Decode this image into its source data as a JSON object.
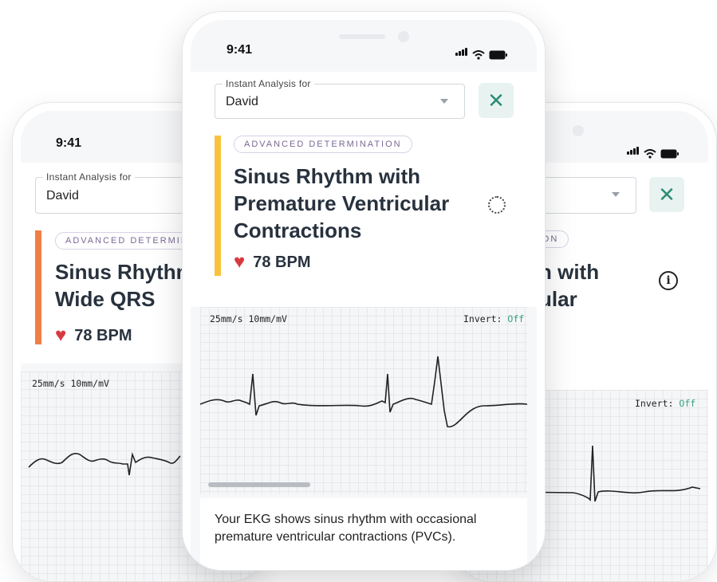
{
  "status_bar": {
    "time": "9:41"
  },
  "analysis": {
    "label": "Instant Analysis for",
    "person": "David",
    "close_glyph": "✕"
  },
  "left_card": {
    "badge": "ADVANCED DETERMINATION",
    "title_line1": "Sinus Rhythm with",
    "title_line2": "Wide QRS",
    "bpm": "78 BPM",
    "accent_color": "#f07f45"
  },
  "center_card": {
    "badge": "ADVANCED DETERMINATION",
    "title": "Sinus Rhythm with Premature Ventricular Contractions",
    "bpm": "78 BPM",
    "accent_color": "#f9c23c",
    "loading_icon": "spinner-icon"
  },
  "right_card": {
    "badge_fragment": "TION",
    "title_line1": "n with",
    "title_line2": "ular",
    "info_icon": "info-icon",
    "info_glyph": "i"
  },
  "ekg": {
    "speed": "25mm/s",
    "gain": "10mm/mV",
    "invert_label": "Invert:",
    "invert_value": "Off"
  },
  "summary": {
    "line1": "Your EKG shows sinus rhythm with occasional",
    "line2": "premature ventricular contractions (PVCs)."
  },
  "colors": {
    "heart": "#d8393f",
    "close_button_bg": "#e8f3f1",
    "close_icon": "#2e8c75",
    "invert_off": "#34a37c",
    "badge_text": "#7a6896"
  }
}
